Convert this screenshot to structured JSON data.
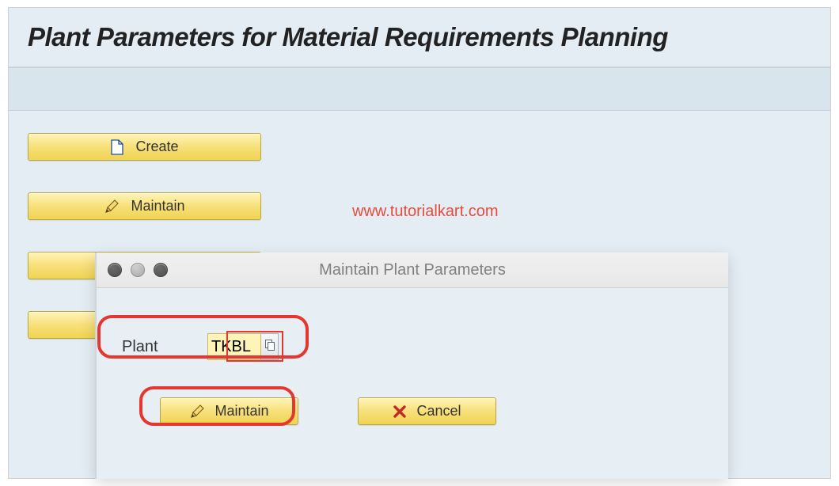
{
  "main": {
    "title": "Plant Parameters for Material Requirements Planning",
    "buttons": {
      "create": "Create",
      "maintain": "Maintain"
    }
  },
  "watermark": "www.tutorialkart.com",
  "dialog": {
    "title": "Maintain Plant Parameters",
    "field": {
      "label": "Plant",
      "value": "TKBL"
    },
    "buttons": {
      "maintain": "Maintain",
      "cancel": "Cancel"
    }
  }
}
